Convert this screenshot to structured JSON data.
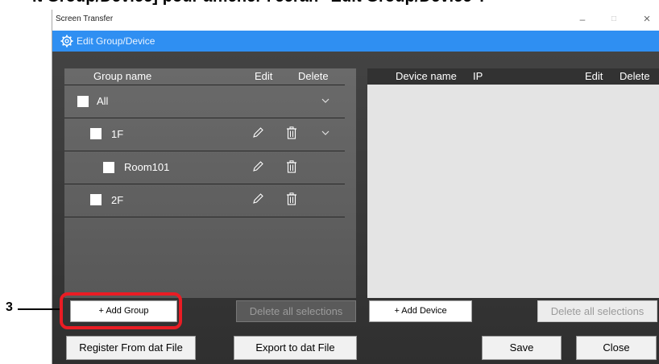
{
  "heading": "it Group/Device] pour afficher l'écran \"Edit Group/Device\".",
  "window": {
    "title": "Screen Transfer",
    "controls": {
      "minimize": "–",
      "maximize": "□",
      "close": "×"
    }
  },
  "header": {
    "title": "Edit Group/Device",
    "icon": "gear-icon"
  },
  "group_panel": {
    "columns": {
      "name": "Group name",
      "edit": "Edit",
      "delete": "Delete"
    },
    "rows": [
      {
        "label": "All",
        "checked": false,
        "editable": false,
        "expandable": true
      },
      {
        "label": "1F",
        "checked": false,
        "editable": true,
        "expandable": true
      },
      {
        "label": "Room101",
        "checked": false,
        "editable": true,
        "expandable": false
      },
      {
        "label": "2F",
        "checked": false,
        "editable": true,
        "expandable": false
      }
    ],
    "add_button": "+ Add Group",
    "delete_all_button": "Delete all selections"
  },
  "device_panel": {
    "columns": {
      "name": "Device name",
      "ip": "IP",
      "edit": "Edit",
      "delete": "Delete"
    },
    "rows": [],
    "add_button": "+ Add Device",
    "delete_all_button": "Delete all selections"
  },
  "footer": {
    "register_button": "Register From dat File",
    "export_button": "Export to dat File",
    "save_button": "Save",
    "close_button": "Close"
  },
  "callout": {
    "number": "3",
    "color": "#ea1c24"
  },
  "colors": {
    "header_blue": "#2f8ff2",
    "window_dark": "#3b3b3b",
    "panel_grey": "#616161",
    "device_list": "#e4e4e4"
  }
}
